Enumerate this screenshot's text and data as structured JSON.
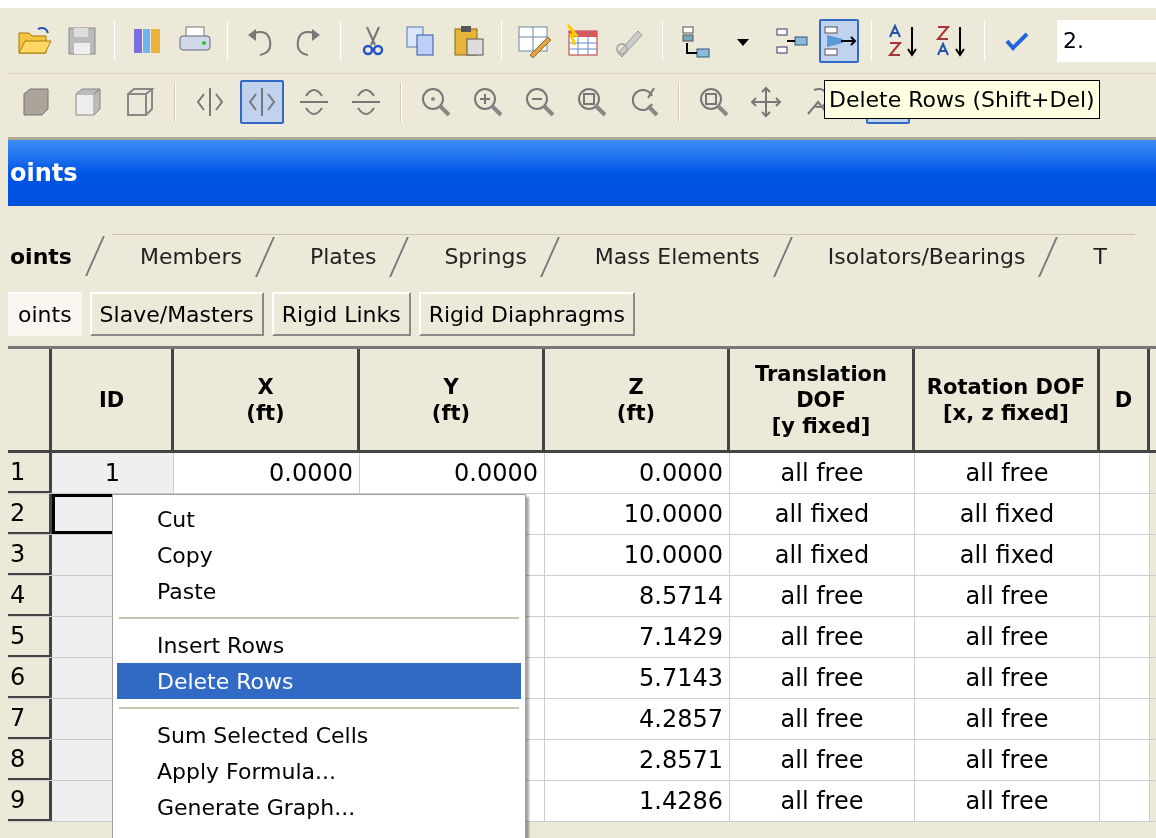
{
  "toolbar_1": [
    {
      "kind": "open",
      "pressed": false
    },
    {
      "kind": "save",
      "pressed": false
    },
    {
      "kind": "sep"
    },
    {
      "kind": "books",
      "pressed": false
    },
    {
      "kind": "print",
      "pressed": false
    },
    {
      "kind": "sep"
    },
    {
      "kind": "undo",
      "pressed": false
    },
    {
      "kind": "redo",
      "pressed": false
    },
    {
      "kind": "sep"
    },
    {
      "kind": "cut",
      "pressed": false
    },
    {
      "kind": "copy",
      "pressed": false
    },
    {
      "kind": "paste",
      "pressed": false
    },
    {
      "kind": "sep"
    },
    {
      "kind": "gridedit",
      "pressed": false
    },
    {
      "kind": "grid",
      "pressed": false
    },
    {
      "kind": "pencil",
      "pressed": false
    },
    {
      "kind": "sep"
    },
    {
      "kind": "insert",
      "pressed": false
    },
    {
      "kind": "caret",
      "pressed": false
    },
    {
      "kind": "insert2",
      "pressed": false
    },
    {
      "kind": "delete",
      "pressed": true
    },
    {
      "kind": "sep"
    },
    {
      "kind": "sortaz",
      "pressed": false
    },
    {
      "kind": "sortza",
      "pressed": false
    },
    {
      "kind": "sep"
    },
    {
      "kind": "check",
      "pressed": false
    }
  ],
  "formula_field": {
    "value": "2."
  },
  "toolbar_2": [
    {
      "kind": "cube1",
      "pressed": false
    },
    {
      "kind": "cube2",
      "pressed": false
    },
    {
      "kind": "cube3",
      "pressed": false
    },
    {
      "kind": "sep"
    },
    {
      "kind": "mirror",
      "pressed": false
    },
    {
      "kind": "mirror",
      "pressed": true
    },
    {
      "kind": "rotx",
      "pressed": false
    },
    {
      "kind": "rotx",
      "pressed": false
    },
    {
      "kind": "sep"
    },
    {
      "kind": "zoom",
      "pressed": false
    },
    {
      "kind": "zoomin",
      "pressed": false
    },
    {
      "kind": "zoomout",
      "pressed": false
    },
    {
      "kind": "zoombox",
      "pressed": false
    },
    {
      "kind": "zoomprev",
      "pressed": false
    },
    {
      "kind": "sep"
    },
    {
      "kind": "zoomfit",
      "pressed": false
    },
    {
      "kind": "pan",
      "pressed": false
    },
    {
      "kind": "rot3d",
      "pressed": false
    },
    {
      "kind": "sep"
    },
    {
      "kind": "blank",
      "pressed": true
    }
  ],
  "tooltip": "Delete Rows (Shift+Del)",
  "window": {
    "title": "oints"
  },
  "tabs": [
    {
      "label": "oints",
      "selected": true
    },
    {
      "label": "Members",
      "selected": false
    },
    {
      "label": "Plates",
      "selected": false
    },
    {
      "label": "Springs",
      "selected": false
    },
    {
      "label": "Mass Elements",
      "selected": false
    },
    {
      "label": "Isolators/Bearings",
      "selected": false
    },
    {
      "label": "T",
      "selected": false
    }
  ],
  "subtabs": [
    {
      "label": "oints",
      "selected": true
    },
    {
      "label": "Slave/Masters",
      "selected": false
    },
    {
      "label": "Rigid Links",
      "selected": false
    },
    {
      "label": "Rigid Diaphragms",
      "selected": false
    }
  ],
  "table": {
    "columns": [
      "",
      "ID",
      "X\n(ft)",
      "Y\n(ft)",
      "Z\n(ft)",
      "Translation\nDOF\n[y fixed]",
      "Rotation DOF\n[x, z fixed]",
      "D"
    ],
    "rows": [
      {
        "cells": [
          "1",
          "1",
          "0.0000",
          "0.0000",
          "0.0000",
          "all free",
          "all free",
          ""
        ],
        "current": false
      },
      {
        "cells": [
          "2",
          "",
          "",
          "",
          "10.0000",
          "all fixed",
          "all fixed",
          ""
        ],
        "current": true
      },
      {
        "cells": [
          "3",
          "",
          "",
          "",
          "10.0000",
          "all fixed",
          "all fixed",
          ""
        ],
        "current": false
      },
      {
        "cells": [
          "4",
          "",
          "",
          "",
          "8.5714",
          "all free",
          "all free",
          ""
        ],
        "current": false
      },
      {
        "cells": [
          "5",
          "",
          "",
          "",
          "7.1429",
          "all free",
          "all free",
          ""
        ],
        "current": false
      },
      {
        "cells": [
          "6",
          "",
          "",
          "",
          "5.7143",
          "all free",
          "all free",
          ""
        ],
        "current": false
      },
      {
        "cells": [
          "7",
          "",
          "",
          "",
          "4.2857",
          "all free",
          "all free",
          ""
        ],
        "current": false
      },
      {
        "cells": [
          "8",
          "",
          "",
          "",
          "2.8571",
          "all free",
          "all free",
          ""
        ],
        "current": false
      },
      {
        "cells": [
          "9",
          "",
          "",
          "",
          "1.4286",
          "all free",
          "all free",
          ""
        ],
        "current": false
      }
    ]
  },
  "context_menu": [
    {
      "kind": "item",
      "label": "Cut",
      "selected": false
    },
    {
      "kind": "item",
      "label": "Copy",
      "selected": false
    },
    {
      "kind": "item",
      "label": "Paste",
      "selected": false
    },
    {
      "kind": "separator"
    },
    {
      "kind": "item",
      "label": "Insert Rows",
      "selected": false
    },
    {
      "kind": "item",
      "label": "Delete Rows",
      "selected": true
    },
    {
      "kind": "separator"
    },
    {
      "kind": "item",
      "label": "Sum Selected Cells",
      "selected": false
    },
    {
      "kind": "item",
      "label": "Apply Formula...",
      "selected": false
    },
    {
      "kind": "item",
      "label": "Generate Graph...",
      "selected": false
    }
  ]
}
